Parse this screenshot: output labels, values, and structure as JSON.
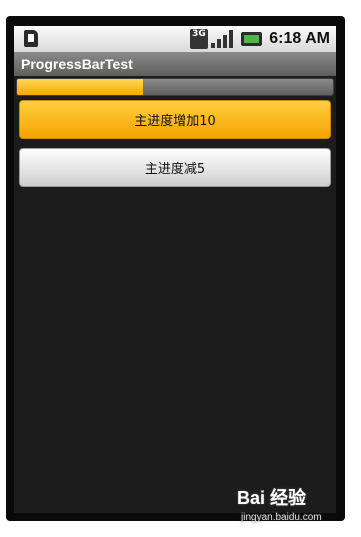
{
  "status_bar": {
    "time": "6:18 AM",
    "network_label": "3G",
    "icons": [
      "sd-card-icon",
      "network-3g-icon",
      "signal-icon",
      "battery-icon"
    ]
  },
  "app": {
    "title": "ProgressBarTest"
  },
  "progress": {
    "value": 40,
    "max": 100
  },
  "buttons": {
    "increase_label": "主进度增加10",
    "decrease_label": "主进度减5"
  },
  "watermark": {
    "brand": "Bai 经验",
    "url": "jingyan.baidu.com"
  },
  "colors": {
    "accent": "#f5a400",
    "background": "#1c1c1c"
  }
}
